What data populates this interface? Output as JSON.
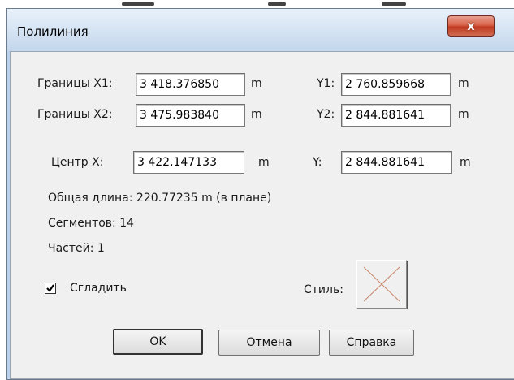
{
  "dialog": {
    "title": "Полилиния",
    "close_label": "x"
  },
  "bounds": {
    "x1_label": "Границы X1:",
    "x1_value": "3 418.376850",
    "x1_unit": "m",
    "y1_label": "Y1:",
    "y1_value": "2 760.859668",
    "y1_unit": "m",
    "x2_label": "Границы X2:",
    "x2_value": "3 475.983840",
    "x2_unit": "m",
    "y2_label": "Y2:",
    "y2_value": "2 844.881641",
    "y2_unit": "m"
  },
  "center": {
    "x_label": "Центр X:",
    "x_value": "3 422.147133",
    "x_unit": "m",
    "y_label": "Y:",
    "y_value": "2 844.881641",
    "y_unit": "m"
  },
  "stats": {
    "total_length": "Общая длина:  220.77235 m (в плане)",
    "segments": "Сегментов:  14",
    "parts": "Частей:  1"
  },
  "smooth": {
    "label": "Сгладить",
    "checked": true
  },
  "style": {
    "label": "Стиль:",
    "icon": "cross-line-style-icon",
    "line_color": "#c8876a"
  },
  "buttons": {
    "ok": "OK",
    "cancel": "Отмена",
    "help": "Справка"
  }
}
